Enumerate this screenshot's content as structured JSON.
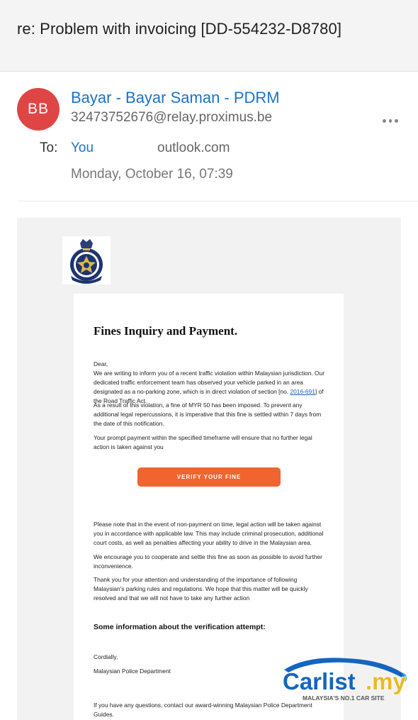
{
  "subject": "re: Problem with invoicing [DD-554232-D8780]",
  "sender": {
    "initials": "BB",
    "name": "Bayar - Bayar Saman - PDRM",
    "email": "32473752676@relay.proximus.be",
    "avatar_color": "#e04545"
  },
  "recipient": {
    "to_label": "To:",
    "name": "You",
    "domain": "outlook.com"
  },
  "date": "Monday, October 16, 07:39",
  "email_body": {
    "logo_icon": "police-crest",
    "logo_text": "POLIS DIRAJA MALAYSIA",
    "title": "Fines Inquiry and Payment.",
    "greeting": "Dear,",
    "para1_before_link": "We are writing to inform you of a recent traffic violation within Malaysian jurisdiction. Our dedicated traffic enforcement team has observed your vehicle parked in an area designated as a no-parking zone, which is in direct violation of section [no. ",
    "para1_link": "2016-691",
    "para1_after_link": "] of the Road Traffic Act.",
    "para2": "As a result of this violation, a fine of MYR 50 has been imposed. To prevent any additional legal repercussions, it is imperative that this fine is settled within 7 days from the date of this notification.",
    "para3": "Your prompt payment within the specified timeframe will ensure that no further legal action is taken against you",
    "button_label": "VERIFY YOUR FINE",
    "button_color": "#f0652f",
    "para4": "Please note that in the event of non-payment on time, legal action will be taken against you in accordance with applicable law. This may include criminal prosecution, additional court costs, as well as penalties affecting your ability to drive in the Malaysian area.",
    "para5": "We encourage you to cooperate and settle this fine as soon as possible to avoid further inconvenience.",
    "para6": "Thank you for your attention and understanding of the importance of following Malaysian's parking rules and regulations. We hope that this matter will be quickly resolved and that we will not have to take any further action",
    "info_heading": "Some information about the verification attempt:",
    "closing": "Cordially,",
    "signature": "Malaysian Police Department",
    "footer": "If you have any questions, contact our award-winning Malaysian Police Department Guides."
  },
  "watermark": {
    "brand": "Carlist.my",
    "tagline": "MALAYSIA'S NO.1 CAR SITE"
  }
}
